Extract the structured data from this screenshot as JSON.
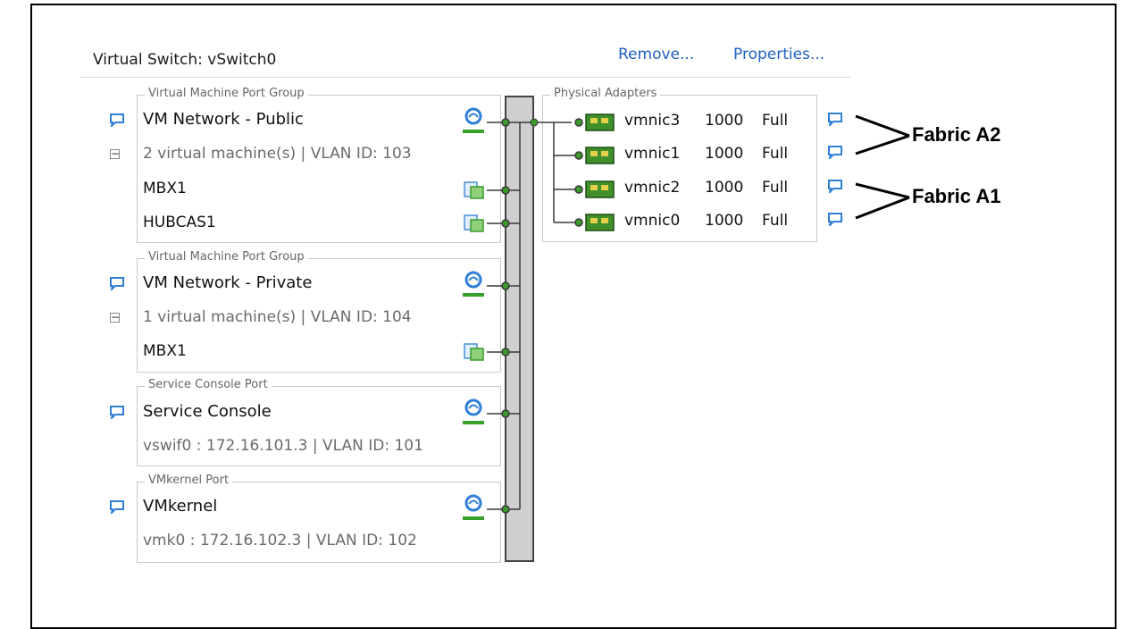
{
  "header": {
    "title": "Virtual Switch: vSwitch0",
    "remove_label": "Remove...",
    "properties_label": "Properties..."
  },
  "port_groups": [
    {
      "legend": "Virtual Machine Port Group",
      "name": "VM Network - Public",
      "summary": "2 virtual machine(s) | VLAN ID: 103",
      "vms": [
        "MBX1",
        "HUBCAS1"
      ]
    },
    {
      "legend": "Virtual Machine Port Group",
      "name": "VM Network - Private",
      "summary": "1 virtual machine(s) | VLAN ID: 104",
      "vms": [
        "MBX1"
      ]
    },
    {
      "legend": "Service Console Port",
      "name": "Service Console",
      "summary": "vswif0 : 172.16.101.3 | VLAN ID: 101"
    },
    {
      "legend": "VMkernel Port",
      "name": "VMkernel",
      "summary": "vmk0 : 172.16.102.3 | VLAN ID: 102"
    }
  ],
  "physical_adapters": {
    "legend": "Physical Adapters",
    "nics": [
      {
        "name": "vmnic3",
        "speed": "1000",
        "duplex": "Full"
      },
      {
        "name": "vmnic1",
        "speed": "1000",
        "duplex": "Full"
      },
      {
        "name": "vmnic2",
        "speed": "1000",
        "duplex": "Full"
      },
      {
        "name": "vmnic0",
        "speed": "1000",
        "duplex": "Full"
      }
    ]
  },
  "annotations": {
    "fabric_a2": "Fabric A2",
    "fabric_a1": "Fabric A1"
  },
  "icons": {
    "bubble": "speech-bubble-icon",
    "port": "network-port-icon",
    "vm": "virtual-machine-icon",
    "nic": "network-card-icon"
  },
  "colors": {
    "link": "#1f5fbf",
    "connector": "#3a9a2a",
    "nic": "#3f8f2a",
    "bubble": "#2f7fd6"
  }
}
